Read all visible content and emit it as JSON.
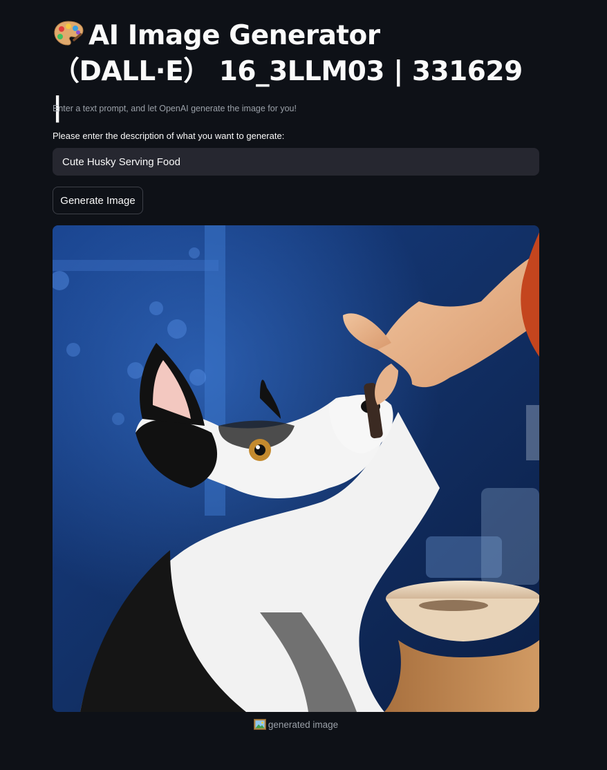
{
  "header": {
    "title": "AI Image Generator （DALL·E） 16_3LLM03 | 331629 |",
    "subtitle": "Enter a text prompt, and let OpenAI generate the image for you!"
  },
  "form": {
    "input_label": "Please enter the description of what you want to generate:",
    "input_value": "Cute Husky Serving Food",
    "button_label": "Generate Image"
  },
  "result": {
    "image_description": "husky being fed a treat",
    "caption": "generated image"
  },
  "icons": {
    "title_icon": "artist-palette-icon",
    "caption_icon": "framed-picture-icon"
  },
  "colors": {
    "background": "#0e1117",
    "input_background": "#262730",
    "text": "#fafafa",
    "muted_text": "#9aa0a8"
  }
}
